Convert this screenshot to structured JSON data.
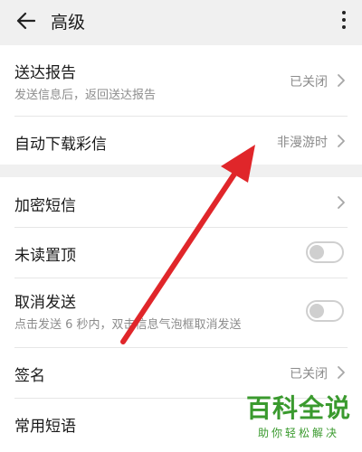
{
  "header": {
    "title": "高级"
  },
  "settings_group_1": [
    {
      "label": "送达报告",
      "sublabel": "发送信息后，返回送达报告",
      "value": "已关闭"
    },
    {
      "label": "自动下载彩信",
      "value": "非漫游时"
    }
  ],
  "settings_group_2": [
    {
      "label": "加密短信"
    },
    {
      "label": "未读置顶",
      "toggle": false
    },
    {
      "label": "取消发送",
      "sublabel": "点击发送 6 秒内，双击信息气泡框取消发送",
      "toggle": false
    },
    {
      "label": "签名",
      "value": "已关闭"
    },
    {
      "label": "常用短语"
    }
  ],
  "watermark": {
    "main": "百科全说",
    "sub": "助你轻松解决"
  },
  "colors": {
    "annotation_arrow": "#e0262a",
    "watermark": "#3a9a2e",
    "background": "#f0f0f0"
  }
}
